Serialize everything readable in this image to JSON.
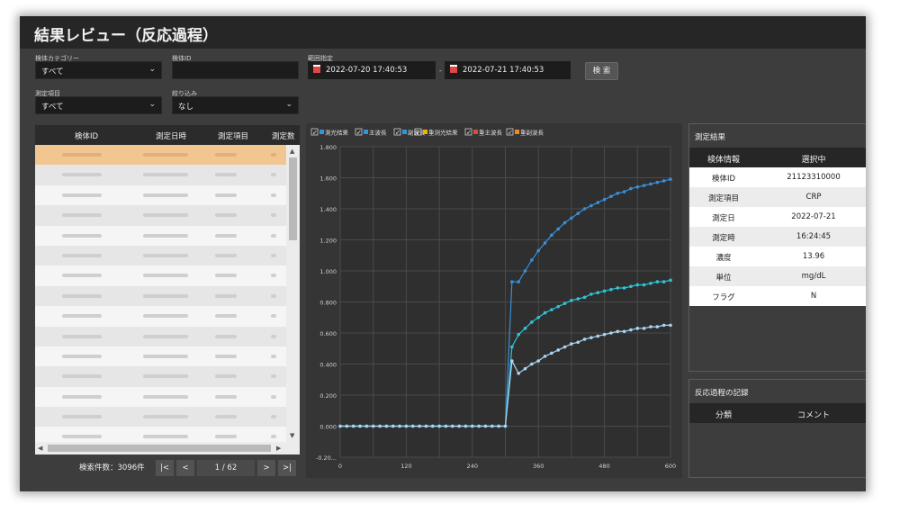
{
  "title": "結果レビュー（反応過程）",
  "filters": {
    "category_label": "検体カテゴリー",
    "category_value": "すべて",
    "sample_id_label": "検体ID",
    "sample_id_value": "",
    "range_label": "範囲指定",
    "date_from": "2022-07-20 17:40:53",
    "date_sep": "-",
    "date_to": "2022-07-21 17:40:53",
    "search_button": "検 索",
    "item_label": "測定項目",
    "item_value": "すべて",
    "filter_label": "絞り込み",
    "filter_value": "なし"
  },
  "table": {
    "columns": [
      "検体ID",
      "測定日時",
      "測定項目",
      "測定数"
    ],
    "row_count_visible": 15,
    "selected_row": 0
  },
  "pager": {
    "count_text": "検索件数：3096件",
    "first": "|<",
    "prev": "<",
    "page": "1 / 62",
    "next": ">",
    "last": ">|"
  },
  "chart_data": {
    "type": "line",
    "legend": [
      "測光結果",
      "主波長",
      "副波長",
      "重測光結果",
      "重主波長",
      "重副波長"
    ],
    "legend_checked": [
      true,
      true,
      true,
      true,
      true,
      true
    ],
    "legend_colors": [
      "#2d9ad6",
      "#2d9ad6",
      "#2d9ad6",
      "#f0b400",
      "#e04a3a",
      "#f08a20"
    ],
    "x_ticks": [
      0,
      120,
      240,
      360,
      480,
      600
    ],
    "y_ticks": [
      "-0.20...",
      "0.000",
      "0.200",
      "0.400",
      "0.600",
      "0.800",
      "1.000",
      "1.200",
      "1.400",
      "1.600",
      "1.800"
    ],
    "xlim": [
      0,
      600
    ],
    "ylim": [
      -0.2,
      1.8
    ],
    "grid": true,
    "series": [
      {
        "color": "#3a8fd8",
        "x": [
          0,
          12,
          24,
          36,
          48,
          60,
          72,
          84,
          96,
          108,
          120,
          132,
          144,
          156,
          168,
          180,
          192,
          204,
          216,
          228,
          240,
          252,
          264,
          276,
          288,
          300,
          312,
          324,
          336,
          348,
          360,
          372,
          384,
          396,
          408,
          420,
          432,
          444,
          456,
          468,
          480,
          492,
          504,
          516,
          528,
          540,
          552,
          564,
          576,
          588,
          600
        ],
        "y": [
          0,
          0,
          0,
          0,
          0,
          0,
          0,
          0,
          0,
          0,
          0,
          0,
          0,
          0,
          0,
          0,
          0,
          0,
          0,
          0,
          0,
          0,
          0,
          0,
          0,
          0,
          0.93,
          0.93,
          1.0,
          1.07,
          1.13,
          1.18,
          1.23,
          1.27,
          1.31,
          1.34,
          1.37,
          1.4,
          1.42,
          1.44,
          1.46,
          1.48,
          1.5,
          1.51,
          1.53,
          1.54,
          1.55,
          1.56,
          1.57,
          1.58,
          1.59
        ]
      },
      {
        "color": "#2ec4d6",
        "x": [
          0,
          12,
          24,
          36,
          48,
          60,
          72,
          84,
          96,
          108,
          120,
          132,
          144,
          156,
          168,
          180,
          192,
          204,
          216,
          228,
          240,
          252,
          264,
          276,
          288,
          300,
          312,
          324,
          336,
          348,
          360,
          372,
          384,
          396,
          408,
          420,
          432,
          444,
          456,
          468,
          480,
          492,
          504,
          516,
          528,
          540,
          552,
          564,
          576,
          588,
          600
        ],
        "y": [
          0,
          0,
          0,
          0,
          0,
          0,
          0,
          0,
          0,
          0,
          0,
          0,
          0,
          0,
          0,
          0,
          0,
          0,
          0,
          0,
          0,
          0,
          0,
          0,
          0,
          0,
          0.51,
          0.59,
          0.63,
          0.67,
          0.7,
          0.73,
          0.75,
          0.77,
          0.79,
          0.81,
          0.82,
          0.83,
          0.85,
          0.86,
          0.87,
          0.88,
          0.89,
          0.89,
          0.9,
          0.91,
          0.91,
          0.92,
          0.93,
          0.93,
          0.94
        ]
      },
      {
        "color": "#a9d4f2",
        "x": [
          0,
          12,
          24,
          36,
          48,
          60,
          72,
          84,
          96,
          108,
          120,
          132,
          144,
          156,
          168,
          180,
          192,
          204,
          216,
          228,
          240,
          252,
          264,
          276,
          288,
          300,
          312,
          324,
          336,
          348,
          360,
          372,
          384,
          396,
          408,
          420,
          432,
          444,
          456,
          468,
          480,
          492,
          504,
          516,
          528,
          540,
          552,
          564,
          576,
          588,
          600
        ],
        "y": [
          0,
          0,
          0,
          0,
          0,
          0,
          0,
          0,
          0,
          0,
          0,
          0,
          0,
          0,
          0,
          0,
          0,
          0,
          0,
          0,
          0,
          0,
          0,
          0,
          0,
          0,
          0.42,
          0.34,
          0.37,
          0.4,
          0.42,
          0.45,
          0.47,
          0.49,
          0.51,
          0.53,
          0.54,
          0.56,
          0.57,
          0.58,
          0.59,
          0.6,
          0.61,
          0.61,
          0.62,
          0.63,
          0.63,
          0.64,
          0.64,
          0.65,
          0.65
        ]
      }
    ]
  },
  "result": {
    "title": "測定結果",
    "header": [
      "検体情報",
      "選択中"
    ],
    "rows": [
      [
        "検体ID",
        "21123310000"
      ],
      [
        "測定項目",
        "CRP"
      ],
      [
        "測定日",
        "2022-07-21"
      ],
      [
        "測定時",
        "16:24:45"
      ],
      [
        "濃度",
        "13.96"
      ],
      [
        "単位",
        "mg/dL"
      ],
      [
        "フラグ",
        "N"
      ]
    ]
  },
  "log": {
    "title": "反応過程の記録",
    "header": [
      "分類",
      "コメント"
    ]
  }
}
